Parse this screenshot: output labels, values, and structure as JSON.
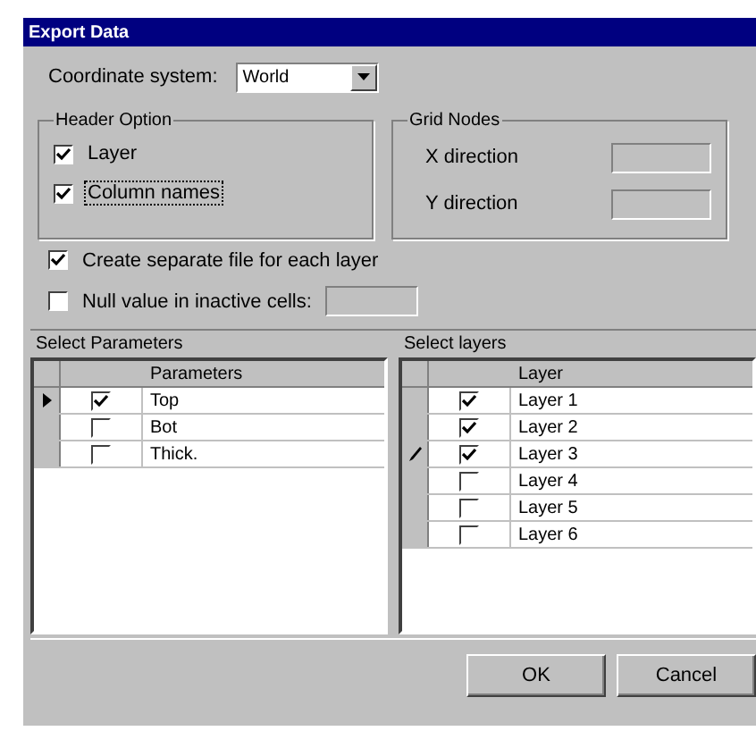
{
  "window": {
    "title": "Export Data"
  },
  "coordinate_system": {
    "label": "Coordinate system:",
    "value": "World"
  },
  "header_option": {
    "title": "Header Option",
    "items": [
      {
        "label": "Layer",
        "checked": true,
        "focused": false
      },
      {
        "label": "Column names",
        "checked": true,
        "focused": true
      }
    ]
  },
  "grid_nodes": {
    "title": "Grid Nodes",
    "fields": [
      {
        "label": "X direction"
      },
      {
        "label": "Y direction"
      }
    ]
  },
  "options": [
    {
      "kind": "checkbox",
      "label": "Create separate file for each layer",
      "checked": true
    },
    {
      "kind": "checkbox_field",
      "label": "Null value in inactive cells:",
      "checked": false
    }
  ],
  "parameters": {
    "title": "Select Parameters",
    "column": "Parameters",
    "rows": [
      {
        "name": "Top",
        "checked": true,
        "current": true,
        "editing": false
      },
      {
        "name": "Bot",
        "checked": false,
        "current": false,
        "editing": false
      },
      {
        "name": "Thick.",
        "checked": false,
        "current": false,
        "editing": false
      }
    ]
  },
  "layers": {
    "title": "Select layers",
    "column": "Layer",
    "rows": [
      {
        "name": "Layer 1",
        "checked": true,
        "current": false,
        "editing": false
      },
      {
        "name": "Layer 2",
        "checked": true,
        "current": false,
        "editing": false
      },
      {
        "name": "Layer 3",
        "checked": true,
        "current": false,
        "editing": true
      },
      {
        "name": "Layer 4",
        "checked": false,
        "current": false,
        "editing": false
      },
      {
        "name": "Layer 5",
        "checked": false,
        "current": false,
        "editing": false
      },
      {
        "name": "Layer 6",
        "checked": false,
        "current": false,
        "editing": false
      }
    ]
  },
  "buttons": [
    "OK",
    "Cancel"
  ]
}
